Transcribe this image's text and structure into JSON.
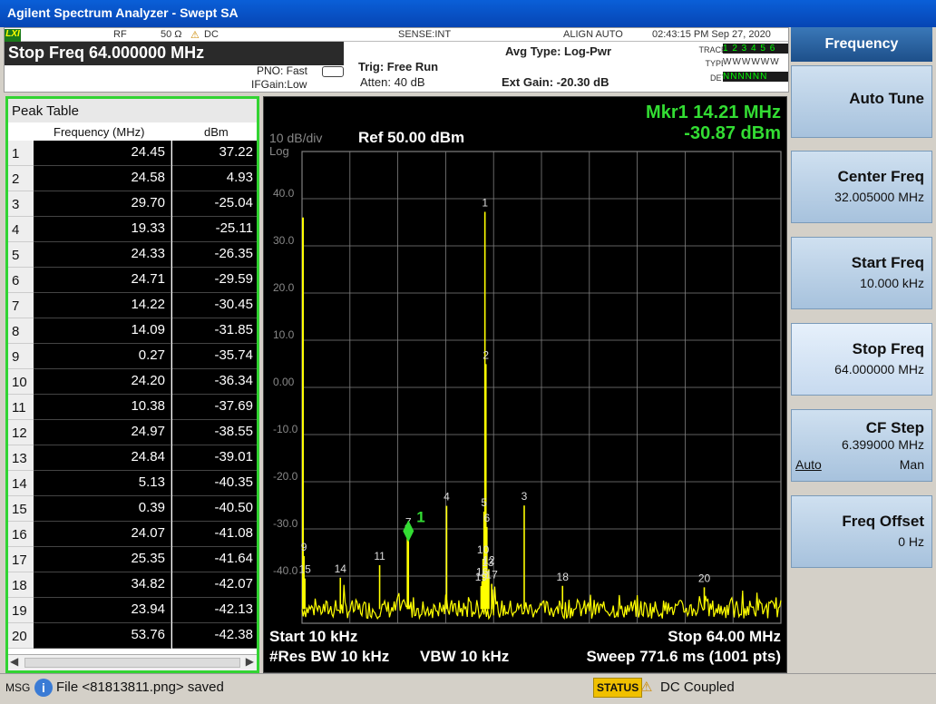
{
  "window": {
    "title": "Agilent Spectrum Analyzer - Swept SA"
  },
  "status_row": {
    "lxi": "LXI",
    "rf": "RF",
    "impedance": "50 Ω",
    "warn": "⚠",
    "coupling": "DC",
    "sense": "SENSE:INT",
    "align": "ALIGN AUTO",
    "datetime": "02:43:15 PM Sep 27, 2020"
  },
  "header": {
    "stop_freq": "Stop Freq 64.000000 MHz",
    "pno": "PNO: Fast",
    "ifgain": "IFGain:Low",
    "trig": "Trig: Free Run",
    "atten": "Atten: 40 dB",
    "avg_type": "Avg Type: Log-Pwr",
    "ext_gain": "Ext Gain: -20.30 dB",
    "trace_label": "TRACE",
    "type_label": "TYPE",
    "det_label": "DET",
    "trace_vals": "1 2 3 4 5 6",
    "type_vals": "WWWWWW",
    "det_vals": "NNNNNN"
  },
  "softkeys": {
    "title": "Frequency",
    "items": [
      {
        "label": "Auto Tune",
        "value": ""
      },
      {
        "label": "Center Freq",
        "value": "32.005000 MHz"
      },
      {
        "label": "Start Freq",
        "value": "10.000 kHz"
      },
      {
        "label": "Stop Freq",
        "value": "64.000000 MHz"
      },
      {
        "label": "CF Step",
        "value": "6.399000 MHz",
        "auto": "Auto",
        "man": "Man"
      },
      {
        "label": "Freq Offset",
        "value": "0 Hz"
      }
    ]
  },
  "peak_table": {
    "title": "Peak Table",
    "col_freq": "Frequency (MHz)",
    "col_amp": "dBm",
    "rows": [
      {
        "i": "1",
        "f": "24.45",
        "a": "37.22"
      },
      {
        "i": "2",
        "f": "24.58",
        "a": "4.93"
      },
      {
        "i": "3",
        "f": "29.70",
        "a": "-25.04"
      },
      {
        "i": "4",
        "f": "19.33",
        "a": "-25.11"
      },
      {
        "i": "5",
        "f": "24.33",
        "a": "-26.35"
      },
      {
        "i": "6",
        "f": "24.71",
        "a": "-29.59"
      },
      {
        "i": "7",
        "f": "14.22",
        "a": "-30.45"
      },
      {
        "i": "8",
        "f": "14.09",
        "a": "-31.85"
      },
      {
        "i": "9",
        "f": "0.27",
        "a": "-35.74"
      },
      {
        "i": "10",
        "f": "24.20",
        "a": "-36.34"
      },
      {
        "i": "11",
        "f": "10.38",
        "a": "-37.69"
      },
      {
        "i": "12",
        "f": "24.97",
        "a": "-38.55"
      },
      {
        "i": "13",
        "f": "24.84",
        "a": "-39.01"
      },
      {
        "i": "14",
        "f": "5.13",
        "a": "-40.35"
      },
      {
        "i": "15",
        "f": "0.39",
        "a": "-40.50"
      },
      {
        "i": "16",
        "f": "24.07",
        "a": "-41.08"
      },
      {
        "i": "17",
        "f": "25.35",
        "a": "-41.64"
      },
      {
        "i": "18",
        "f": "34.82",
        "a": "-42.07"
      },
      {
        "i": "19",
        "f": "23.94",
        "a": "-42.13"
      },
      {
        "i": "20",
        "f": "53.76",
        "a": "-42.38"
      }
    ]
  },
  "graph": {
    "scale": "10 dB/div",
    "log": "Log",
    "ref": "Ref 50.00 dBm",
    "marker_freq": "Mkr1 14.21 MHz",
    "marker_amp": "-30.87 dBm",
    "start": "Start 10 kHz",
    "stop": "Stop 64.00 MHz",
    "rbw": "#Res BW 10 kHz",
    "vbw": "VBW 10 kHz",
    "sweep": "Sweep  771.6 ms (1001 pts)",
    "marker_num": "1"
  },
  "chart_data": {
    "type": "line",
    "xlim": [
      0.01,
      64.0
    ],
    "ylim": [
      -50,
      50
    ],
    "yticks": [
      40.0,
      30.0,
      20.0,
      10.0,
      0.0,
      -10.0,
      -20.0,
      -30.0,
      -40.0
    ],
    "ytick_labels": [
      "40.0",
      "30.0",
      "20.0",
      "10.0",
      "0.00",
      "-10.0",
      "-20.0",
      "-30.0",
      "-40.0"
    ],
    "noise_floor": -47,
    "peaks": [
      {
        "label": "1",
        "x": 24.45,
        "y": 37.22
      },
      {
        "label": "2",
        "x": 24.58,
        "y": 4.93
      },
      {
        "label": "3",
        "x": 29.7,
        "y": -25.04
      },
      {
        "label": "4",
        "x": 19.33,
        "y": -25.11
      },
      {
        "label": "5",
        "x": 24.33,
        "y": -26.35
      },
      {
        "label": "6",
        "x": 24.71,
        "y": -29.59
      },
      {
        "label": "7",
        "x": 14.22,
        "y": -30.45
      },
      {
        "label": "8",
        "x": 14.09,
        "y": -31.85
      },
      {
        "label": "9",
        "x": 0.27,
        "y": -35.74
      },
      {
        "label": "10",
        "x": 24.2,
        "y": -36.34
      },
      {
        "label": "11",
        "x": 10.38,
        "y": -37.69
      },
      {
        "label": "12",
        "x": 24.97,
        "y": -38.55
      },
      {
        "label": "13",
        "x": 24.84,
        "y": -39.01
      },
      {
        "label": "14",
        "x": 5.13,
        "y": -40.35
      },
      {
        "label": "15",
        "x": 0.39,
        "y": -40.5
      },
      {
        "label": "16",
        "x": 24.07,
        "y": -41.08
      },
      {
        "label": "17",
        "x": 25.35,
        "y": -41.64
      },
      {
        "label": "18",
        "x": 34.82,
        "y": -42.07
      },
      {
        "label": "19",
        "x": 23.94,
        "y": -42.13
      },
      {
        "label": "20",
        "x": 53.76,
        "y": -42.38
      }
    ],
    "trace_color": "#ffff00",
    "grid_color": "#808080",
    "marker_color": "#33dd33"
  },
  "message_bar": {
    "msg_label": "MSG",
    "message": "File <81813811.png> saved",
    "status_label": "STATUS",
    "status_text": "DC Coupled"
  }
}
